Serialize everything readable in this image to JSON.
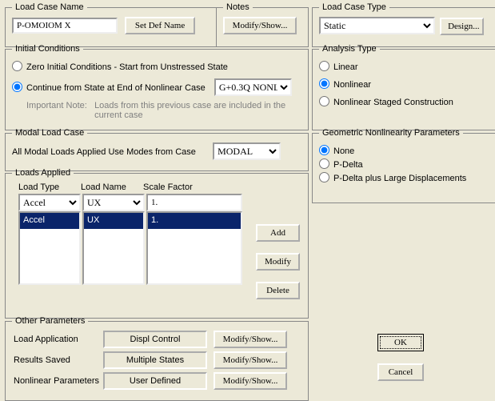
{
  "lcn": {
    "legend": "Load Case Name",
    "value": "P-OMOIOM X",
    "btn": "Set Def Name"
  },
  "notes": {
    "legend": "Notes",
    "btn": "Modify/Show..."
  },
  "lct": {
    "legend": "Load Case Type",
    "sel": "Static",
    "btn": "Design..."
  },
  "ic": {
    "legend": "Initial Conditions",
    "o1": "Zero Initial Conditions - Start from Unstressed State",
    "o2": "Continue from State at End of Nonlinear Case",
    "sel": "G+0.3Q NONL",
    "note1": "Important Note:",
    "note2": "Loads from this previous case are included in the current case"
  },
  "at": {
    "legend": "Analysis Type",
    "o1": "Linear",
    "o2": "Nonlinear",
    "o3": "Nonlinear Staged Construction"
  },
  "mlc": {
    "legend": "Modal Load Case",
    "lbl": "All Modal Loads Applied Use Modes from Case",
    "sel": "MODAL"
  },
  "gnp": {
    "legend": "Geometric Nonlinearity Parameters",
    "o1": "None",
    "o2": "P-Delta",
    "o3": "P-Delta plus Large Displacements"
  },
  "la": {
    "legend": "Loads Applied",
    "h1": "Load Type",
    "h2": "Load Name",
    "h3": "Scale Factor",
    "type": "Accel",
    "name": "UX",
    "sf": "1.",
    "rtype": "Accel",
    "rname": "UX",
    "rsf": "1.",
    "add": "Add",
    "mod": "Modify",
    "del": "Delete"
  },
  "op": {
    "legend": "Other Parameters",
    "l1": "Load Application",
    "v1": "Displ Control",
    "l2": "Results Saved",
    "v2": "Multiple States",
    "l3": "Nonlinear Parameters",
    "v3": "User Defined",
    "ms": "Modify/Show..."
  },
  "ok": "OK",
  "cancel": "Cancel"
}
